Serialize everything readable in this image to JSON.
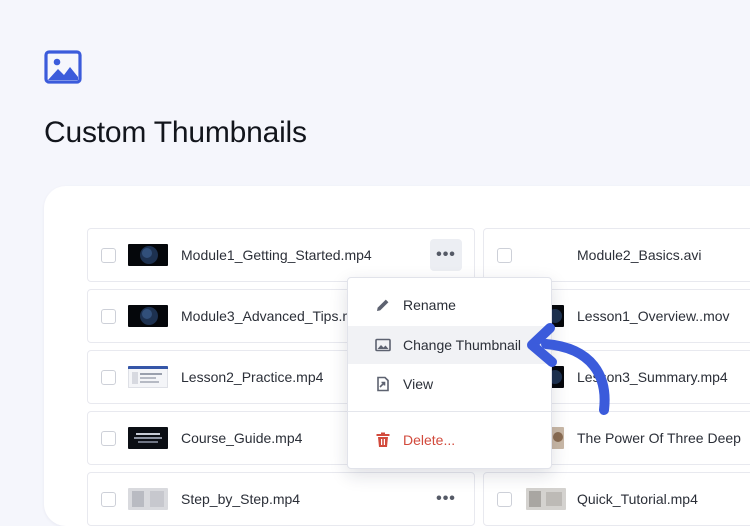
{
  "page": {
    "title": "Custom Thumbnails"
  },
  "files": {
    "left": [
      {
        "name": "Module1_Getting_Started.mp4",
        "thumb": "space"
      },
      {
        "name": "Module3_Advanced_Tips.mp4",
        "thumb": "space"
      },
      {
        "name": "Lesson2_Practice.mp4",
        "thumb": "screen"
      },
      {
        "name": "Course_Guide.mp4",
        "thumb": "dark"
      },
      {
        "name": "Step_by_Step.mp4",
        "thumb": "gray"
      }
    ],
    "right": [
      {
        "name": "Module2_Basics.avi",
        "thumb": "none"
      },
      {
        "name": "Lesson1_Overview..mov",
        "thumb": "space"
      },
      {
        "name": "Lesson3_Summary.mp4",
        "thumb": "space"
      },
      {
        "name": "The Power Of Three Deep",
        "thumb": "face"
      },
      {
        "name": "Quick_Tutorial.mp4",
        "thumb": "gray"
      }
    ]
  },
  "menu": {
    "rename": "Rename",
    "change_thumbnail": "Change Thumbnail",
    "view": "View",
    "delete": "Delete..."
  },
  "colors": {
    "accent": "#3b5bdb",
    "danger": "#d24a3c",
    "background": "#f5f6fc"
  },
  "icons": {
    "hero": "image-icon",
    "rename": "pencil-icon",
    "change_thumbnail": "image-icon",
    "view": "open-file-icon",
    "delete": "trash-icon",
    "more": "more-horizontal-icon"
  }
}
